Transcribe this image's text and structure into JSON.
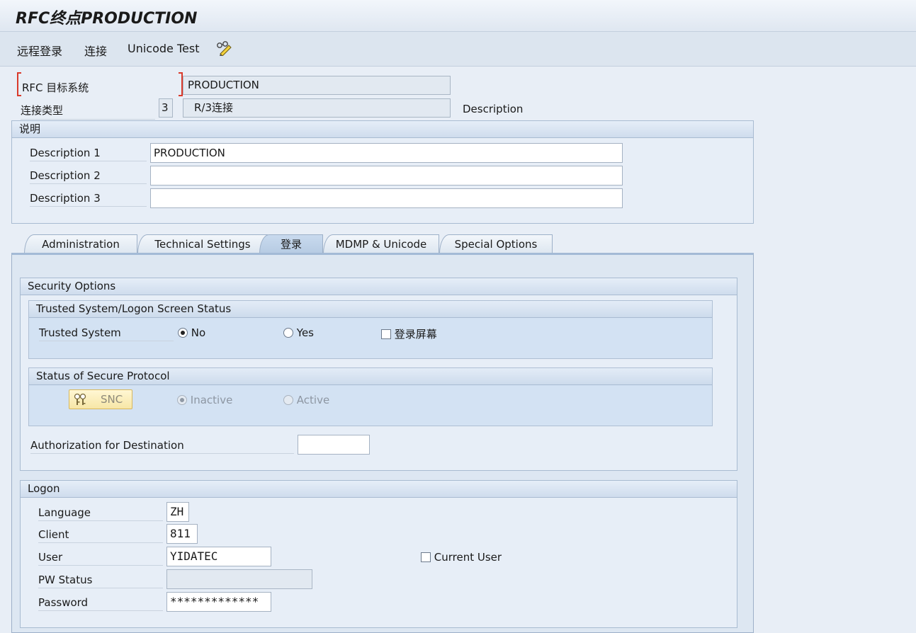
{
  "window": {
    "title": "RFC终点PRODUCTION"
  },
  "toolbar": {
    "items": [
      "远程登录",
      "连接",
      "Unicode Test"
    ],
    "edit_icon": "pencil-glasses-icon"
  },
  "header": {
    "rfc_target_label": "RFC 目标系统",
    "rfc_target_value": "PRODUCTION",
    "conn_type_label": "连接类型",
    "conn_type_code": "3",
    "conn_type_value": "R/3连接",
    "description_label": "Description"
  },
  "description_group": {
    "title": "说明",
    "rows": [
      {
        "label": "Description 1",
        "value": "PRODUCTION"
      },
      {
        "label": "Description 2",
        "value": ""
      },
      {
        "label": "Description 3",
        "value": ""
      }
    ]
  },
  "tabs": [
    {
      "label": "Administration",
      "active": false
    },
    {
      "label": "Technical Settings",
      "active": false
    },
    {
      "label": "登录",
      "active": true
    },
    {
      "label": "MDMP & Unicode",
      "active": false
    },
    {
      "label": "Special Options",
      "active": false
    }
  ],
  "security": {
    "title": "Security Options",
    "trusted": {
      "title": "Trusted System/Logon Screen Status",
      "label": "Trusted System",
      "no_label": "No",
      "yes_label": "Yes",
      "logon_screen_label": "登录屏幕",
      "selected": "No"
    },
    "secure_protocol": {
      "title": "Status of Secure Protocol",
      "snc_button": "SNC",
      "inactive_label": "Inactive",
      "active_label": "Active",
      "selected": "Inactive"
    },
    "authorization_label": "Authorization for Destination",
    "authorization_value": ""
  },
  "logon": {
    "title": "Logon",
    "language_label": "Language",
    "language_value": "ZH",
    "client_label": "Client",
    "client_value": "811",
    "user_label": "User",
    "user_value": "YIDATEC",
    "current_user_label": "Current User",
    "pw_status_label": "PW Status",
    "pw_status_value": "",
    "password_label": "Password",
    "password_value": "*************"
  }
}
